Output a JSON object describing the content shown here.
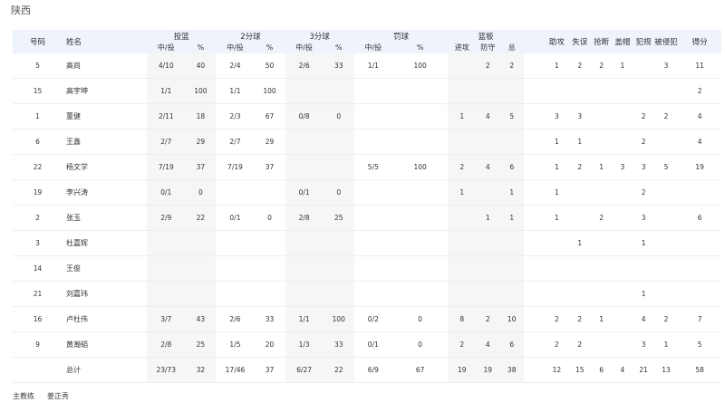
{
  "team_name": "陕西",
  "headers": {
    "number": "号码",
    "name": "姓名",
    "fg": "投篮",
    "two": "2分球",
    "three": "3分球",
    "ft": "罚球",
    "reb": "篮板",
    "made_att": "中/投",
    "pct": "%",
    "off": "进攻",
    "def": "防守",
    "tot": "总",
    "ast": "助攻",
    "tov": "失误",
    "stl": "抢断",
    "blk": "盖帽",
    "pf": "犯规",
    "fd": "被侵犯",
    "pts": "得分"
  },
  "rows": [
    {
      "num": "5",
      "name": "高尚",
      "fg": "4/10",
      "fg_pct": "40",
      "two": "2/4",
      "two_pct": "50",
      "three": "2/6",
      "three_pct": "33",
      "ft": "1/1",
      "ft_pct": "100",
      "off": "",
      "def": "2",
      "tot": "2",
      "ast": "1",
      "tov": "2",
      "stl": "2",
      "blk": "1",
      "pf": "",
      "fd": "3",
      "pts": "11"
    },
    {
      "num": "15",
      "name": "高宇坤",
      "fg": "1/1",
      "fg_pct": "100",
      "two": "1/1",
      "two_pct": "100",
      "three": "",
      "three_pct": "",
      "ft": "",
      "ft_pct": "",
      "off": "",
      "def": "",
      "tot": "",
      "ast": "",
      "tov": "",
      "stl": "",
      "blk": "",
      "pf": "",
      "fd": "",
      "pts": "2"
    },
    {
      "num": "1",
      "name": "董健",
      "fg": "2/11",
      "fg_pct": "18",
      "two": "2/3",
      "two_pct": "67",
      "three": "0/8",
      "three_pct": "0",
      "ft": "",
      "ft_pct": "",
      "off": "1",
      "def": "4",
      "tot": "5",
      "ast": "3",
      "tov": "3",
      "stl": "",
      "blk": "",
      "pf": "2",
      "fd": "2",
      "pts": "4"
    },
    {
      "num": "6",
      "name": "王鑫",
      "fg": "2/7",
      "fg_pct": "29",
      "two": "2/7",
      "two_pct": "29",
      "three": "",
      "three_pct": "",
      "ft": "",
      "ft_pct": "",
      "off": "",
      "def": "",
      "tot": "",
      "ast": "1",
      "tov": "1",
      "stl": "",
      "blk": "",
      "pf": "2",
      "fd": "",
      "pts": "4"
    },
    {
      "num": "22",
      "name": "杨文学",
      "fg": "7/19",
      "fg_pct": "37",
      "two": "7/19",
      "two_pct": "37",
      "three": "",
      "three_pct": "",
      "ft": "5/5",
      "ft_pct": "100",
      "off": "2",
      "def": "4",
      "tot": "6",
      "ast": "1",
      "tov": "2",
      "stl": "1",
      "blk": "3",
      "pf": "3",
      "fd": "5",
      "pts": "19"
    },
    {
      "num": "19",
      "name": "李兴涛",
      "fg": "0/1",
      "fg_pct": "0",
      "two": "",
      "two_pct": "",
      "three": "0/1",
      "three_pct": "0",
      "ft": "",
      "ft_pct": "",
      "off": "1",
      "def": "",
      "tot": "1",
      "ast": "1",
      "tov": "",
      "stl": "",
      "blk": "",
      "pf": "2",
      "fd": "",
      "pts": ""
    },
    {
      "num": "2",
      "name": "张玉",
      "fg": "2/9",
      "fg_pct": "22",
      "two": "0/1",
      "two_pct": "0",
      "three": "2/8",
      "three_pct": "25",
      "ft": "",
      "ft_pct": "",
      "off": "",
      "def": "1",
      "tot": "1",
      "ast": "1",
      "tov": "",
      "stl": "2",
      "blk": "",
      "pf": "3",
      "fd": "",
      "pts": "6"
    },
    {
      "num": "3",
      "name": "杜嘉辉",
      "fg": "",
      "fg_pct": "",
      "two": "",
      "two_pct": "",
      "three": "",
      "three_pct": "",
      "ft": "",
      "ft_pct": "",
      "off": "",
      "def": "",
      "tot": "",
      "ast": "",
      "tov": "1",
      "stl": "",
      "blk": "",
      "pf": "1",
      "fd": "",
      "pts": ""
    },
    {
      "num": "14",
      "name": "王俊",
      "fg": "",
      "fg_pct": "",
      "two": "",
      "two_pct": "",
      "three": "",
      "three_pct": "",
      "ft": "",
      "ft_pct": "",
      "off": "",
      "def": "",
      "tot": "",
      "ast": "",
      "tov": "",
      "stl": "",
      "blk": "",
      "pf": "",
      "fd": "",
      "pts": ""
    },
    {
      "num": "21",
      "name": "刘嘉玮",
      "fg": "",
      "fg_pct": "",
      "two": "",
      "two_pct": "",
      "three": "",
      "three_pct": "",
      "ft": "",
      "ft_pct": "",
      "off": "",
      "def": "",
      "tot": "",
      "ast": "",
      "tov": "",
      "stl": "",
      "blk": "",
      "pf": "1",
      "fd": "",
      "pts": ""
    },
    {
      "num": "16",
      "name": "卢杜伟",
      "fg": "3/7",
      "fg_pct": "43",
      "two": "2/6",
      "two_pct": "33",
      "three": "1/1",
      "three_pct": "100",
      "ft": "0/2",
      "ft_pct": "0",
      "off": "8",
      "def": "2",
      "tot": "10",
      "ast": "2",
      "tov": "2",
      "stl": "1",
      "blk": "",
      "pf": "4",
      "fd": "2",
      "pts": "7"
    },
    {
      "num": "9",
      "name": "黄瀚韬",
      "fg": "2/8",
      "fg_pct": "25",
      "two": "1/5",
      "two_pct": "20",
      "three": "1/3",
      "three_pct": "33",
      "ft": "0/1",
      "ft_pct": "0",
      "off": "2",
      "def": "4",
      "tot": "6",
      "ast": "2",
      "tov": "2",
      "stl": "",
      "blk": "",
      "pf": "3",
      "fd": "1",
      "pts": "5"
    }
  ],
  "totals": {
    "label": "总计",
    "fg": "23/73",
    "fg_pct": "32",
    "two": "17/46",
    "two_pct": "37",
    "three": "6/27",
    "three_pct": "22",
    "ft": "6/9",
    "ft_pct": "67",
    "off": "19",
    "def": "19",
    "tot": "38",
    "ast": "12",
    "tov": "15",
    "stl": "6",
    "blk": "4",
    "pf": "21",
    "fd": "13",
    "pts": "58"
  },
  "coach": {
    "label": "主教练",
    "name": "姜正秀"
  }
}
